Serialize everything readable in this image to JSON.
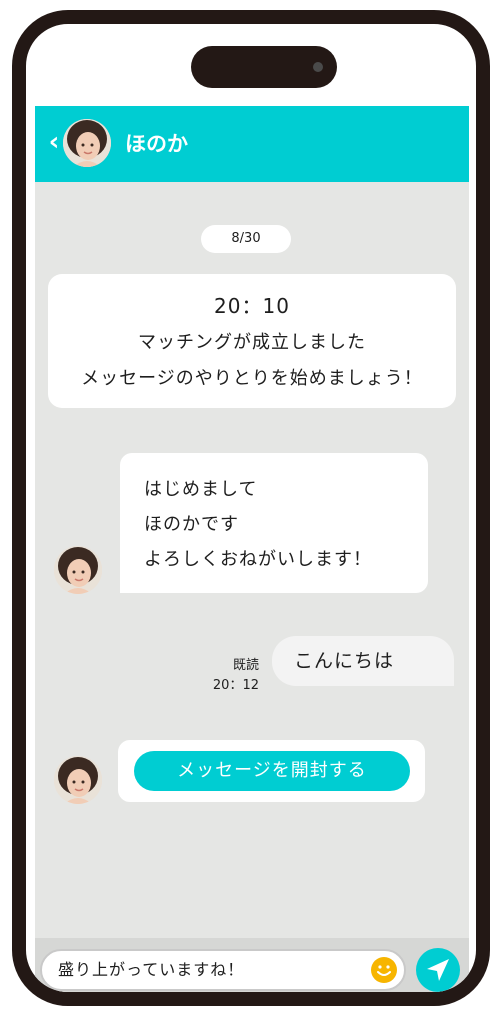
{
  "header": {
    "title": "ほのか",
    "back_icon": "chevron-left-icon",
    "back_glyph": "‹"
  },
  "chat": {
    "date": "8/30",
    "system": {
      "time": "20：10",
      "line1": "マッチングが成立しました",
      "line2": "メッセージのやりとりを始めましょう！"
    },
    "incoming": {
      "lines": [
        "はじめまして",
        "ほのかです",
        "よろしくおねがいします！"
      ]
    },
    "outgoing": {
      "text": "こんにちは",
      "read_label": "既読",
      "time": "20：12"
    },
    "locked_message": {
      "button_label": "メッセージを開封する"
    }
  },
  "composer": {
    "value": "盛り上がっていますね！",
    "emoji_icon": "smiley-icon",
    "send_icon": "paper-plane-icon"
  },
  "colors": {
    "accent": "#00cdd2",
    "background": "#e5e6e4",
    "frame": "#231815",
    "emoji": "#f7b500"
  }
}
